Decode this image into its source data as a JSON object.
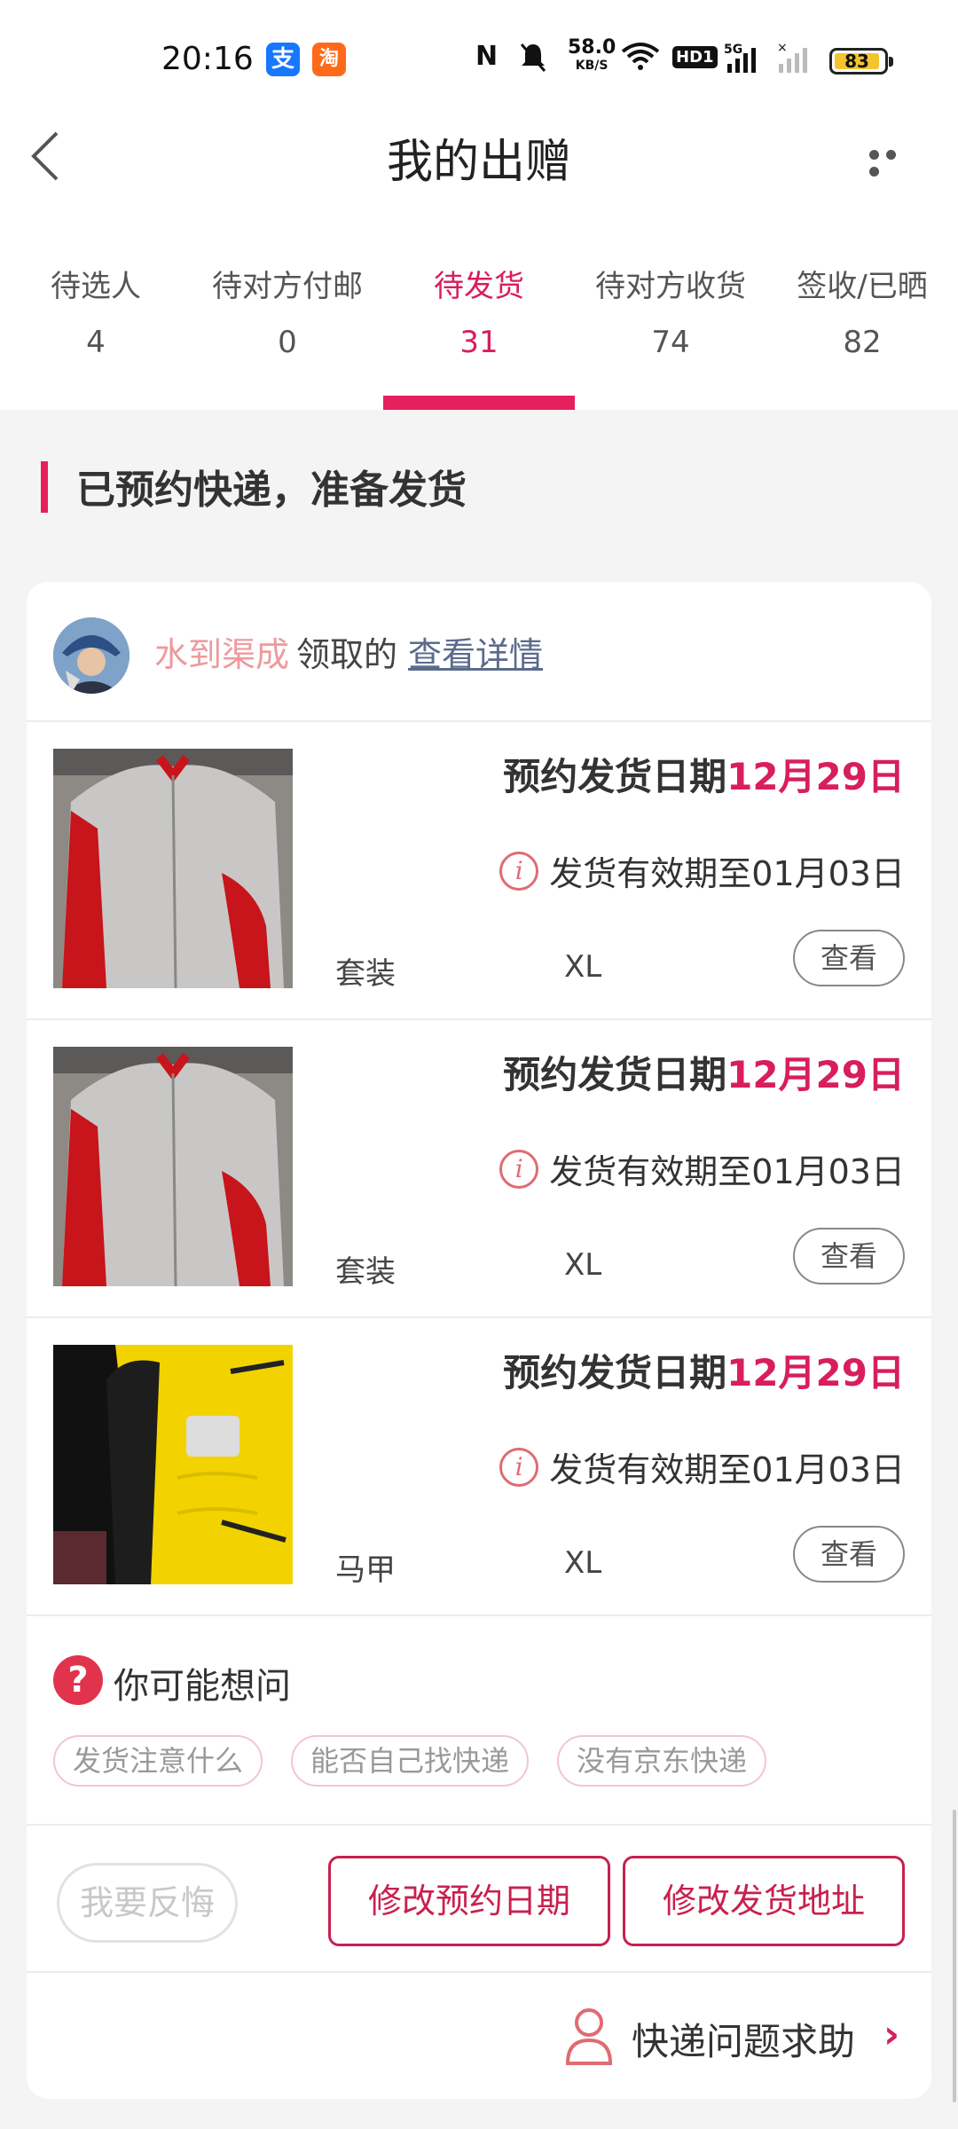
{
  "status_bar": {
    "time": "20:16",
    "net_speed_value": "58.0",
    "net_speed_unit": "KB/S",
    "battery": "83",
    "hd_label": "HD1",
    "signal_label": "5G"
  },
  "header": {
    "title": "我的出赠"
  },
  "tabs": [
    {
      "label": "待选人",
      "count": "4"
    },
    {
      "label": "待对方付邮",
      "count": "0"
    },
    {
      "label": "待发货",
      "count": "31"
    },
    {
      "label": "待对方收货",
      "count": "74"
    },
    {
      "label": "签收/已晒",
      "count": "82"
    }
  ],
  "section": {
    "title": "已预约快递，准备发货"
  },
  "claimer": {
    "name": "水到渠成",
    "text": "领取的",
    "link": "查看详情"
  },
  "items": [
    {
      "ship_label": "预约发货日期",
      "ship_date": "12月29日",
      "valid_text": "发货有效期至01月03日",
      "kind": "套装",
      "size": "XL",
      "view": "查看"
    },
    {
      "ship_label": "预约发货日期",
      "ship_date": "12月29日",
      "valid_text": "发货有效期至01月03日",
      "kind": "套装",
      "size": "XL",
      "view": "查看"
    },
    {
      "ship_label": "预约发货日期",
      "ship_date": "12月29日",
      "valid_text": "发货有效期至01月03日",
      "kind": "马甲",
      "size": "XL",
      "view": "查看"
    }
  ],
  "faq": {
    "title": "你可能想问",
    "chips": [
      "发货注意什么",
      "能否自己找快递",
      "没有京东快递"
    ]
  },
  "actions": {
    "regret": "我要反悔",
    "change_date": "修改预约日期",
    "change_address": "修改发货地址"
  },
  "help": {
    "label": "快递问题求助"
  },
  "colors": {
    "accent": "#e6205e",
    "accent_text": "#d81e5b",
    "claimer_name": "#ee9a9d"
  }
}
